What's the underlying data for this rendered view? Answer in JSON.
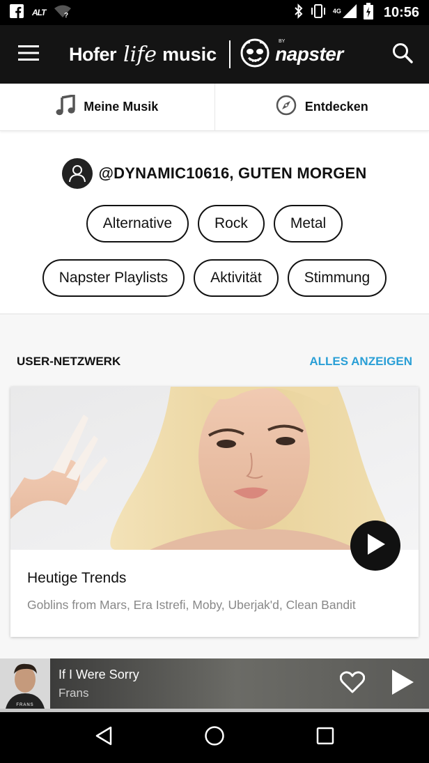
{
  "status_bar": {
    "time": "10:56",
    "network": "4G",
    "alt_label": "ALT",
    "icons": [
      "facebook-icon",
      "alt-icon",
      "wifi-icon",
      "bluetooth-icon",
      "vibrate-icon",
      "signal-icon",
      "battery-icon"
    ]
  },
  "app_bar": {
    "brand_hofer": "Hofer",
    "brand_life": "life",
    "brand_music": "music",
    "partner_by": "BY",
    "partner": "napster",
    "menu_icon": "hamburger-menu-icon",
    "search_icon": "search-icon"
  },
  "tabs": [
    {
      "label": "Meine Musik",
      "icon": "music-note-icon"
    },
    {
      "label": "Entdecken",
      "icon": "compass-icon"
    }
  ],
  "greeting": {
    "text": "@DYNAMIC10616, GUTEN MORGEN",
    "icon": "user-avatar-icon"
  },
  "genre_chips": {
    "row1": [
      "Alternative",
      "Rock",
      "Metal"
    ],
    "row2": [
      "Napster Playlists",
      "Aktivität",
      "Stimmung"
    ]
  },
  "section": {
    "title": "USER-NETZWERK",
    "link": "ALLES ANZEIGEN",
    "link_color": "#2a9fd6"
  },
  "card": {
    "title": "Heutige Trends",
    "subtitle": "Goblins from Mars, Era Istrefi, Moby, Uberjak'd, Clean Bandit",
    "play_icon": "play-icon"
  },
  "now_playing": {
    "title": "If I Were Sorry",
    "artist": "Frans",
    "art_label": "FRANS",
    "progress": 0.0,
    "heart_icon": "heart-outline-icon",
    "play_icon": "play-icon"
  },
  "nav_bar": {
    "icons": [
      "back-icon",
      "home-icon",
      "recents-icon"
    ]
  }
}
